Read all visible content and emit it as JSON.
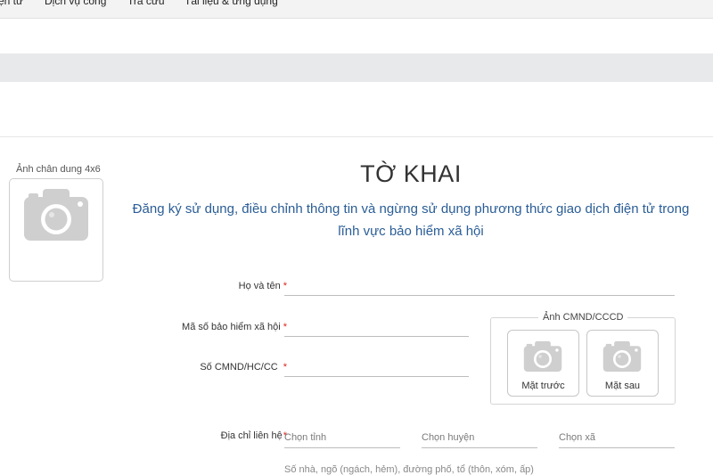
{
  "topnav": {
    "items": [
      {
        "label": "ện tử"
      },
      {
        "label": "Dịch vụ công"
      },
      {
        "label": "Tra cứu"
      },
      {
        "label": "Tài liệu & ứng dụng"
      }
    ]
  },
  "portrait": {
    "label": "Ảnh chân dung 4x6",
    "icon": "camera-icon"
  },
  "form": {
    "title": "TỜ KHAI",
    "subtitle": "Đăng ký sử dụng, điều chỉnh thông tin và ngừng sử dụng phương thức giao dịch điện tử trong lĩnh vực bảo hiểm xã hội",
    "required_marker": "*",
    "fields": {
      "full_name": {
        "label": "Họ và tên",
        "value": ""
      },
      "social_insurance_code": {
        "label": "Mã số bảo hiểm xã hội",
        "value": ""
      },
      "id_number": {
        "label": "Số CMND/HC/CC",
        "value": ""
      },
      "contact_address": {
        "label": "Địa chỉ liên hệ",
        "province_placeholder": "Chọn tỉnh",
        "district_placeholder": "Chọn huyện",
        "commune_placeholder": "Chọn xã",
        "street_hint": "Số nhà, ngõ (ngách, hẻm), đường phố, tổ (thôn, xóm, ấp)"
      }
    },
    "id_photos": {
      "legend": "Ảnh CMND/CCCD",
      "front_label": "Mặt trước",
      "back_label": "Mặt sau",
      "icon": "camera-icon"
    }
  },
  "colors": {
    "subtitle": "#2a5d96",
    "required": "#d9251d",
    "camera": "#cfcfcf"
  }
}
